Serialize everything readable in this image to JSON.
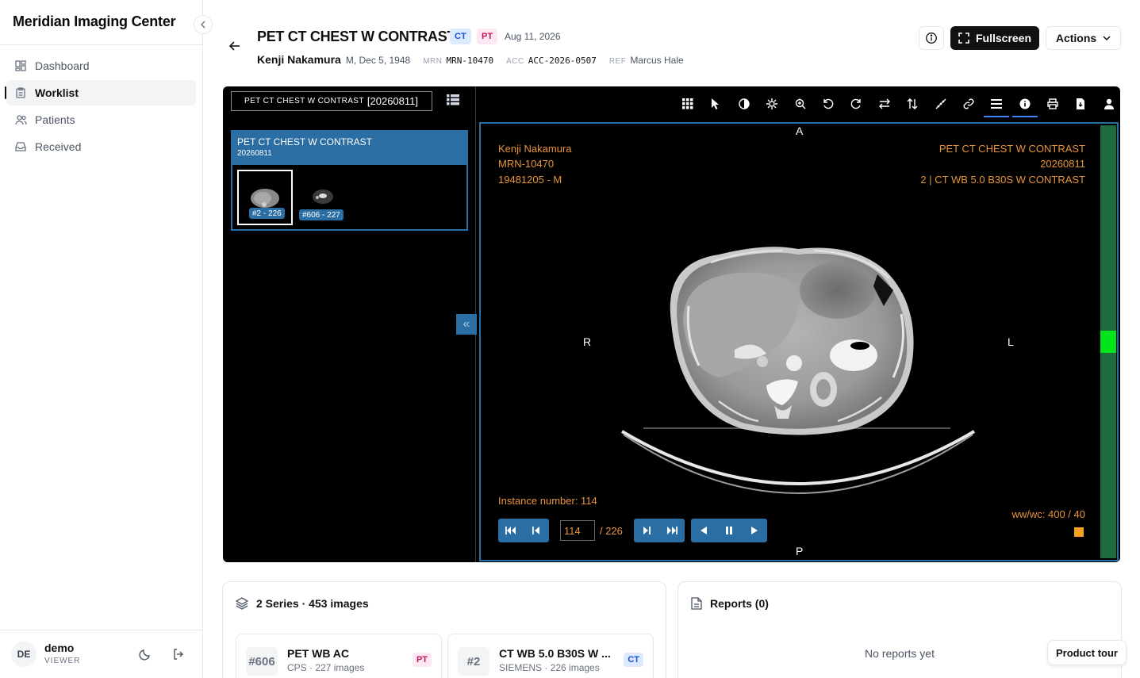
{
  "app": {
    "title": "Meridian Imaging Center"
  },
  "sidebar": {
    "items": [
      {
        "label": "Dashboard",
        "icon": "dashboard-icon"
      },
      {
        "label": "Worklist",
        "icon": "clipboard-icon",
        "active": true
      },
      {
        "label": "Patients",
        "icon": "users-icon"
      },
      {
        "label": "Received",
        "icon": "inbox-icon"
      }
    ],
    "user": {
      "initials": "DE",
      "name": "demo",
      "role": "VIEWER"
    }
  },
  "header": {
    "title": "PET CT CHEST W CONTRAST",
    "modalities": [
      "CT",
      "PT"
    ],
    "date": "Aug 11, 2026",
    "patient": "Kenji Nakamura",
    "patient_sub": "M, Dec 5, 1948",
    "mrn_label": "MRN",
    "mrn": "MRN-10470",
    "acc_label": "ACC",
    "acc": "ACC-2026-0507",
    "ref_label": "REF",
    "ref": "Marcus Hale",
    "fullscreen_label": "Fullscreen",
    "actions_label": "Actions"
  },
  "viewer": {
    "study_select": {
      "desc": "PET CT CHEST W CONTRAST",
      "date": "[20260811]"
    },
    "series_group": {
      "title": "PET CT CHEST W CONTRAST",
      "date": "20260811"
    },
    "thumbnails": [
      {
        "label": "#2 - 226",
        "selected": true
      },
      {
        "label": "#606 - 227",
        "selected": false
      }
    ],
    "toggle_label": "«",
    "tools": [
      "layout-grid-icon",
      "pointer-icon",
      "contrast-icon",
      "pan-icon",
      "zoom-icon",
      "rotate-left-icon",
      "rotate-right-icon",
      "flip-horizontal-icon",
      "flip-vertical-icon",
      "measure-icon",
      "link-icon",
      "menu-icon",
      "info-icon",
      "print-icon",
      "download-icon",
      "user-icon"
    ],
    "overlay": {
      "patient_name": "Kenji Nakamura",
      "mrn": "MRN-10470",
      "dob_sex": "19481205 - M",
      "study_desc": "PET CT CHEST W CONTRAST",
      "study_date": "20260811",
      "series_desc": "2 | CT WB 5.0 B30S W CONTRAST",
      "instance": "Instance number: 114",
      "wwwc": "ww/wc: 400 / 40"
    },
    "orientation": {
      "top": "A",
      "bottom": "P",
      "left": "R",
      "right": "L"
    },
    "frame": {
      "current": "114",
      "total": "/ 226"
    },
    "slice_position": 0.5
  },
  "series_panel": {
    "title": "2 Series · 453 images",
    "items": [
      {
        "num": "#606",
        "name": "PET WB AC",
        "sub": "CPS · 227 images",
        "modality": "PT"
      },
      {
        "num": "#2",
        "name": "CT WB 5.0 B30S W ...",
        "sub": "SIEMENS · 226 images",
        "modality": "CT"
      }
    ]
  },
  "reports_panel": {
    "title": "Reports (0)",
    "empty": "No reports yet"
  },
  "tour_label": "Product tour",
  "colors": {
    "accent": "#2b6ea3",
    "overlay": "#e8943a",
    "ct_badge": "#dbeafe",
    "pt_badge": "#fce7f3"
  }
}
